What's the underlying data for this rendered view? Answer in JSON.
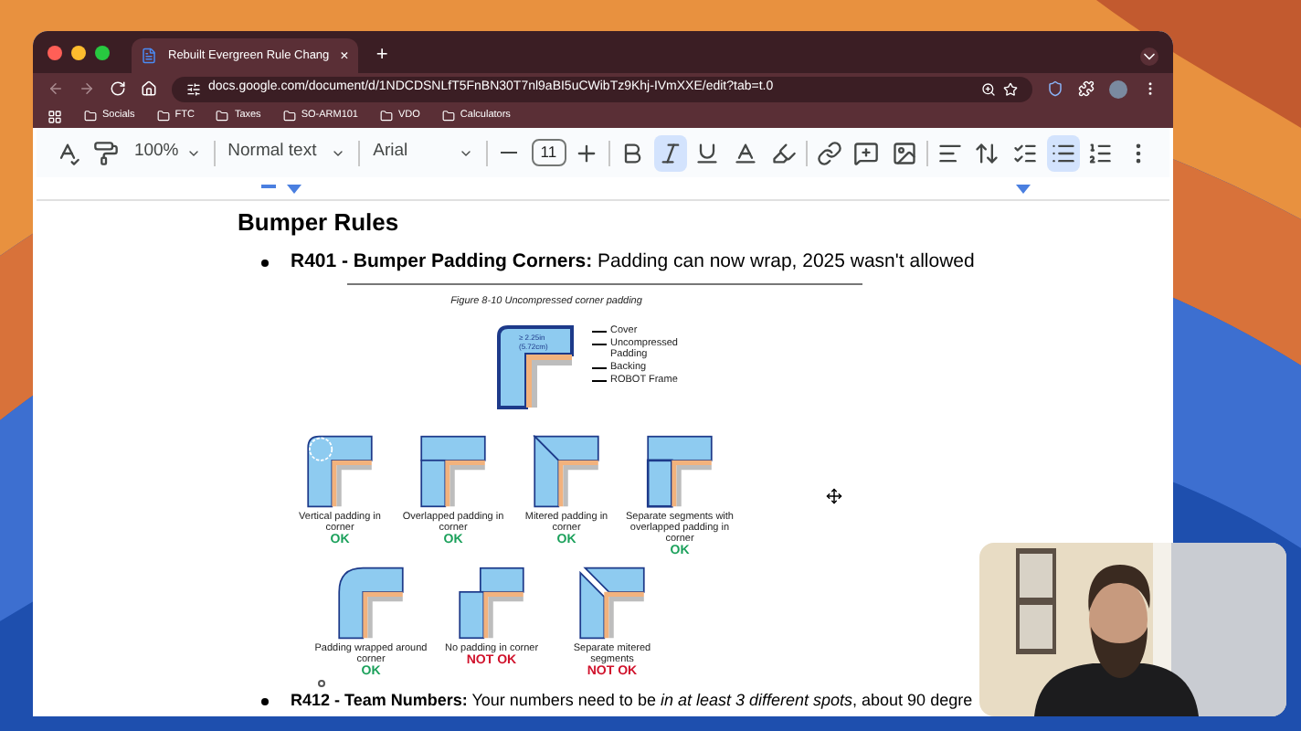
{
  "browser": {
    "tab": {
      "title": "Rebuilt Evergreen Rule Chang",
      "close": "×"
    },
    "new_tab": "+",
    "url": "docs.google.com/document/d/1NDCDSNLfT5FnBN30T7nl9aBI5uCWibTz9Khj-IVmXXE/edit?tab=t.0",
    "bookmarks": [
      "Socials",
      "FTC",
      "Taxes",
      "SO-ARM101",
      "VDO",
      "Calculators"
    ]
  },
  "toolbar": {
    "zoom": "100%",
    "style": "Normal text",
    "font": "Arial",
    "font_size": "11",
    "bold": {
      "active": false
    },
    "italic": {
      "active": true
    },
    "underline": {
      "active": false
    },
    "bulleted_list": {
      "active": true
    }
  },
  "document": {
    "heading": "Bumper Rules",
    "rules": [
      {
        "text": "**R401 - Bumper Padding Corners:** Padding can now wrap, 2025 wasn't allowed"
      },
      {
        "text": "**R412 - Team Numbers:** Your numbers need to be *in at least 3 different spots*, about 90 degre"
      }
    ],
    "figure": {
      "caption": "Figure 8-10 Uncompressed corner padding",
      "dimension": "≥ 2.25in (5.72cm)",
      "layers": [
        "Cover",
        "Uncompressed Padding",
        "Backing",
        "ROBOT Frame"
      ],
      "rows": [
        [
          {
            "kind": "vertical",
            "label": "Vertical padding in corner",
            "verdict": "OK",
            "ok": true
          },
          {
            "kind": "overlapped",
            "label": "Overlapped padding in corner",
            "verdict": "OK",
            "ok": true
          },
          {
            "kind": "mitered",
            "label": "Mitered padding in corner",
            "verdict": "OK",
            "ok": true
          },
          {
            "kind": "separate",
            "label": "Separate segments with overlapped padding in corner",
            "verdict": "OK",
            "ok": true
          }
        ],
        [
          {
            "kind": "wrapped",
            "label": "Padding wrapped around corner",
            "verdict": "OK",
            "ok": true
          },
          {
            "kind": "none",
            "label": "No padding in corner",
            "verdict": "NOT OK",
            "ok": false
          },
          {
            "kind": "separate_mitered",
            "label": "Separate mitered segments",
            "verdict": "NOT OK",
            "ok": false
          }
        ]
      ]
    }
  }
}
